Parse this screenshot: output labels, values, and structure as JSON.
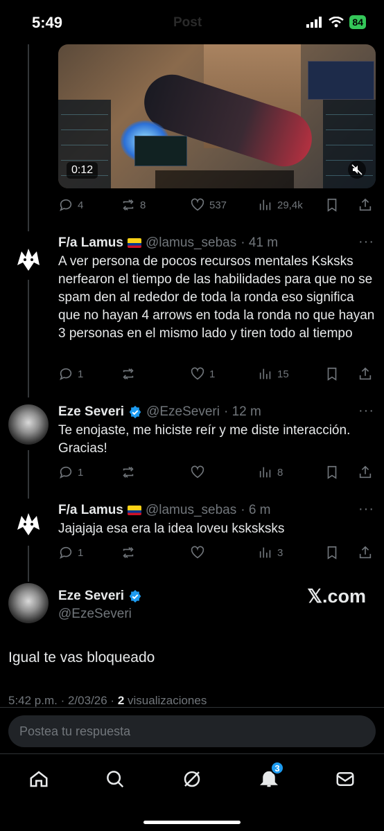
{
  "status": {
    "time": "5:49",
    "ghost_title": "Post",
    "battery": "84"
  },
  "video": {
    "duration": "0:12"
  },
  "video_actions": {
    "replies": "4",
    "reposts": "8",
    "likes": "537",
    "views": "29,4k"
  },
  "tweets": [
    {
      "name": "F/a Lamus",
      "handle": "@lamus_sebas",
      "time": "· 41 m",
      "text": "A ver persona de pocos recursos mentales Ksksks nerfearon el tiempo de las habilidades para que no se spam den al rededor de toda la ronda eso significa que no hayan 4 arrows en toda la ronda no que hayan 3 personas en el mismo lado y tiren todo al tiempo",
      "replies": "1",
      "reposts": "",
      "likes": "1",
      "views": "15"
    },
    {
      "name": "Eze Severi",
      "handle": "@EzeSeveri",
      "time": "· 12 m",
      "text": "Te enojaste, me hiciste reír y me diste interacción. Gracias!",
      "replies": "1",
      "reposts": "",
      "likes": "",
      "views": "8"
    },
    {
      "name": "F/a Lamus",
      "handle": "@lamus_sebas",
      "time": "· 6 m",
      "text": "Jajajaja esa era la idea loveu ksksksks",
      "replies": "1",
      "reposts": "",
      "likes": "",
      "views": "3"
    }
  ],
  "main": {
    "name": "Eze Severi",
    "handle": "@EzeSeveri",
    "watermark": "𝕏.com",
    "text": "Igual te vas bloqueado",
    "meta_prefix": "5:42 p.m. · 2/03/26 · ",
    "views_count": "2",
    "views_label": " visualizaciones"
  },
  "reply": {
    "placeholder": "Postea tu respuesta"
  },
  "tabbar": {
    "notifications_badge": "3"
  },
  "colors": {
    "accent": "#1d9bf0",
    "muted": "#71767b",
    "battery": "#34c759"
  },
  "icons": [
    "home-icon",
    "search-icon",
    "grok-icon",
    "bell-icon",
    "mail-icon"
  ]
}
